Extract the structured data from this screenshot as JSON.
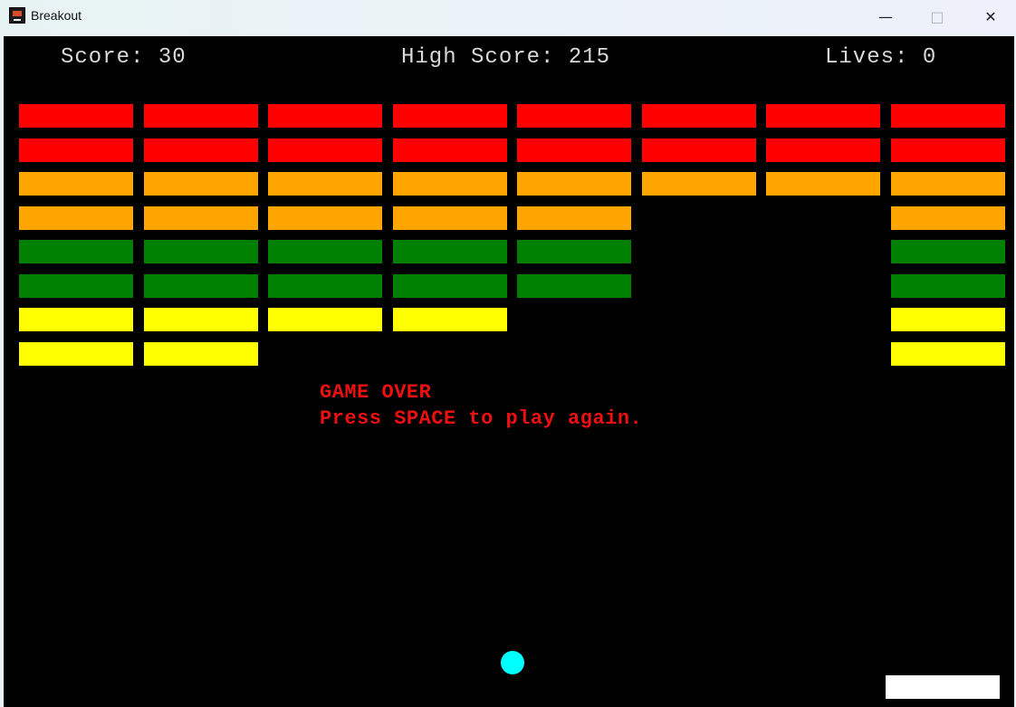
{
  "window": {
    "title": "Breakout",
    "minimize_glyph": "—",
    "maximize_glyph": "□",
    "close_glyph": "✕"
  },
  "hud": {
    "score": "Score: 30",
    "high_score": "High Score: 215",
    "lives": "Lives: 0"
  },
  "message": {
    "line1": "GAME OVER",
    "line2": "Press SPACE to play again."
  },
  "colors": {
    "red": "#ff0000",
    "orange": "#ffa500",
    "green": "#008000",
    "yellow": "#ffff00",
    "ball": "#00ffff",
    "paddle": "#ffffff",
    "message": "#ee1010"
  },
  "bricks": {
    "columns": 8,
    "rows": [
      {
        "color": "red",
        "present": [
          1,
          1,
          1,
          1,
          1,
          1,
          1,
          1
        ]
      },
      {
        "color": "red",
        "present": [
          1,
          1,
          1,
          1,
          1,
          1,
          1,
          1
        ]
      },
      {
        "color": "orange",
        "present": [
          1,
          1,
          1,
          1,
          1,
          1,
          1,
          1
        ]
      },
      {
        "color": "orange",
        "present": [
          1,
          1,
          1,
          1,
          1,
          0,
          0,
          1
        ]
      },
      {
        "color": "green",
        "present": [
          1,
          1,
          1,
          1,
          1,
          0,
          0,
          1
        ]
      },
      {
        "color": "green",
        "present": [
          1,
          1,
          1,
          1,
          1,
          0,
          0,
          1
        ]
      },
      {
        "color": "yellow",
        "present": [
          1,
          1,
          1,
          1,
          0,
          0,
          0,
          1
        ]
      },
      {
        "color": "yellow",
        "present": [
          1,
          1,
          0,
          0,
          0,
          0,
          0,
          1
        ]
      }
    ]
  }
}
